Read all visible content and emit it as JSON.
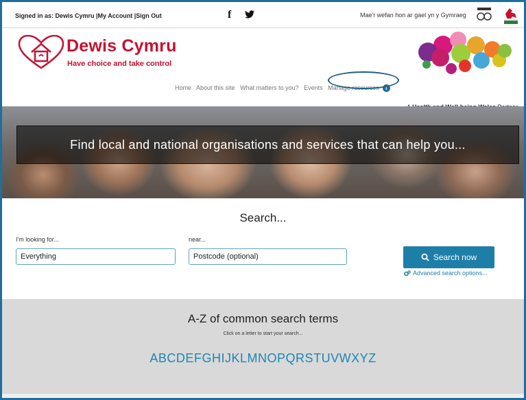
{
  "topbar": {
    "signed_in": "Signed in as: Dewis Cymru |My Account |Sign Out",
    "facebook_glyph": "f",
    "twitter_glyph": "🐦",
    "language_text": "Mae'r wefan hon ar gael yn y Gymraeg",
    "icons": [
      "language-glasses-icon",
      "welsh-dragon-icon"
    ]
  },
  "header": {
    "logo_title": "Dewis Cymru",
    "logo_tagline": "Have choice and take control",
    "nav": [
      "Home",
      "About this site",
      "What matters to you?",
      "Events",
      "Manage resources"
    ],
    "info_marker": "i",
    "partner_prefix": "A ",
    "partner_bold": "Health and Well-being Wales",
    "partner_suffix": " Partner"
  },
  "hero": {
    "text": "Find local and national organisations and services that can help you..."
  },
  "search": {
    "title": "Search...",
    "looking_for_label": "I'm looking for...",
    "looking_for_value": "Everything",
    "near_label": "near...",
    "near_placeholder": "Postcode (optional)",
    "button_label": "Search now",
    "advanced_label": "Advanced search options..."
  },
  "az": {
    "title": "A-Z of common search terms",
    "subtitle": "Click on a letter to start your search...",
    "letters": [
      "A",
      "B",
      "C",
      "D",
      "E",
      "F",
      "G",
      "H",
      "I",
      "J",
      "K",
      "L",
      "M",
      "N",
      "O",
      "P",
      "Q",
      "R",
      "S",
      "T",
      "U",
      "V",
      "W",
      "X",
      "Y",
      "Z"
    ]
  },
  "colors": {
    "brand_red": "#c4122f",
    "accent_blue": "#1d7ea8",
    "frame_blue": "#1f6e9c",
    "az_background": "#d9d9d9"
  }
}
